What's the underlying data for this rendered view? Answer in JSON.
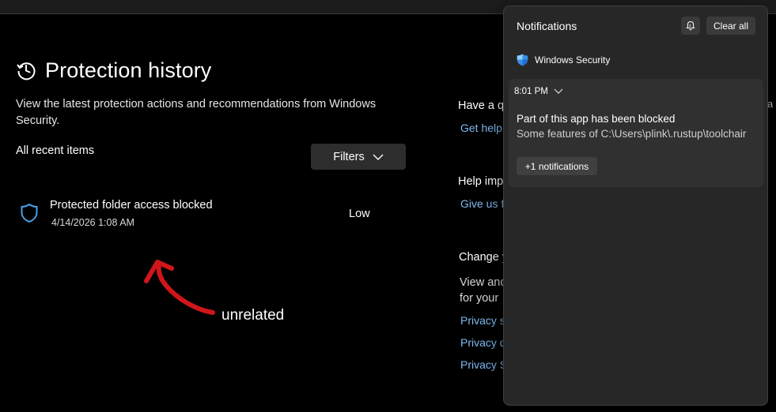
{
  "main": {
    "title": "Protection history",
    "description": "View the latest protection actions and recommendations from Windows Security.",
    "recent_label": "All recent items",
    "filters_label": "Filters",
    "items": [
      {
        "name": "Protected folder access blocked",
        "date": "4/14/2026 1:08 AM",
        "severity": "Low"
      }
    ]
  },
  "annotation": {
    "text": "unrelated",
    "color": "#d0161a"
  },
  "side": {
    "have_question": "Have a q",
    "get_help": "Get help",
    "help_improve": "Help imp",
    "give_us": "Give us f",
    "change": "Change y",
    "view_and": "View and",
    "for_your": "for your",
    "privacy_1": "Privacy s",
    "privacy_2": "Privacy d",
    "privacy_3": "Privacy S",
    "far_right_char": "a"
  },
  "notifications": {
    "title": "Notifications",
    "focus_icon": "focus-assist-icon",
    "clear_all": "Clear all",
    "app_name": "Windows Security",
    "time": "8:01 PM",
    "notification_title": "Part of this app has been blocked",
    "notification_body": "Some features of C:\\Users\\plink\\.rustup\\toolchair",
    "more": "+1 notifications"
  },
  "colors": {
    "link": "#7fbaf0",
    "shield_blue": "#4c9fe8",
    "panel_bg": "#272727"
  }
}
